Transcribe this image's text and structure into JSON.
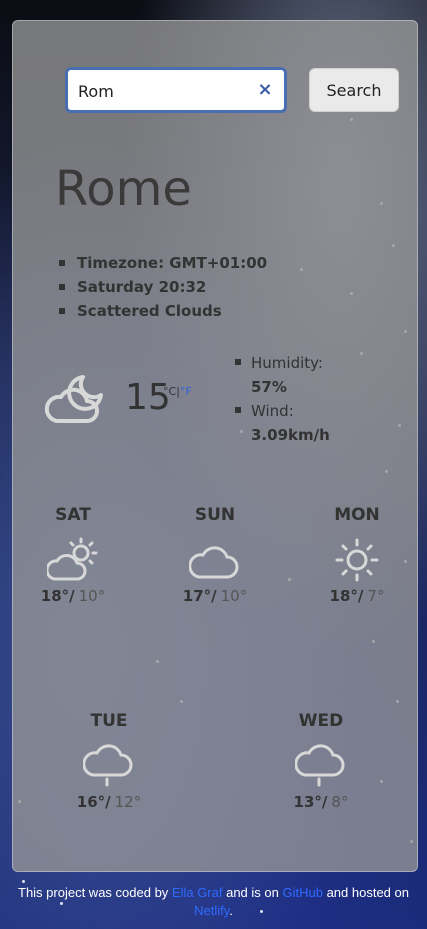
{
  "search": {
    "value": "Rom",
    "button_label": "Search"
  },
  "city": "Rome",
  "info": {
    "timezone": "Timezone: GMT+01:00",
    "day_time": "Saturday 20:32",
    "description": "Scattered Clouds"
  },
  "current": {
    "icon": "cloud-moon-icon",
    "temperature": "15",
    "unit_c": "°C",
    "separator": "|",
    "unit_f": "°F",
    "humidity_label": "Humidity:",
    "humidity_value": "57%",
    "wind_label": "Wind:",
    "wind_value": "3.09km/h"
  },
  "forecast": [
    {
      "day": "SAT",
      "icon": "cloud-sun-icon",
      "high": "18°/",
      "low": "10°"
    },
    {
      "day": "SUN",
      "icon": "cloud-icon",
      "high": "17°/",
      "low": "10°"
    },
    {
      "day": "MON",
      "icon": "sun-icon",
      "high": "18°/",
      "low": "7°"
    },
    {
      "day": "TUE",
      "icon": "cloud-drizzle-icon",
      "high": "16°/",
      "low": "12°"
    },
    {
      "day": "WED",
      "icon": "cloud-drizzle-icon",
      "high": "13°/",
      "low": "8°"
    }
  ],
  "footer": {
    "text1": "This project was coded by ",
    "author": "Ella Graf",
    "text2": " and is on ",
    "github": "GitHub",
    "text3": " and hosted on ",
    "netlify": "Netlify",
    "text4": "."
  },
  "colors": {
    "accent_link": "#2f6bff",
    "input_border": "#4a6fb0"
  }
}
